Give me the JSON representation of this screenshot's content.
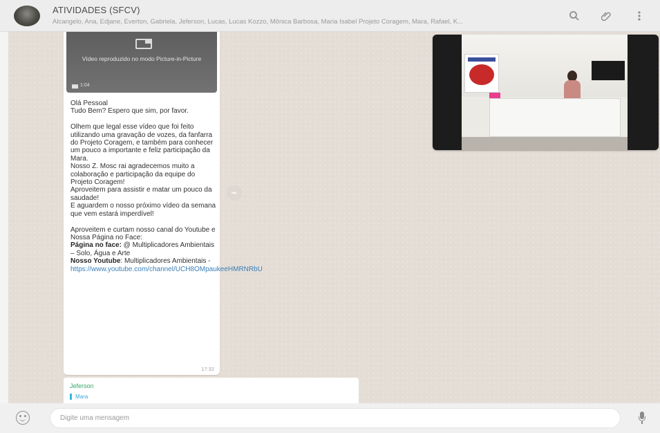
{
  "header": {
    "title": "ATIVIDADES (SFCV)",
    "members": "Alcangelo, Ana, Edjane, Everton, Gabriela, Jeferson, Lucas, Lucas Kozzo, Mônica Barbosa, Maria Isabel Projeto Coragem, Mara, Rafael, K...",
    "icons": {
      "search": "search-icon",
      "attach": "paperclip-icon",
      "menu": "menu-icon"
    }
  },
  "message": {
    "video_caption": "Vídeo reproduzido no modo Picture-in-Picture",
    "video_duration": "1:04",
    "lines": {
      "p1": "Olá Pessoal\nTudo Bem? Espero que sim, por favor.\n\nOlhem que legal esse vídeo que foi feito utilizando uma gravação de vozes, da fanfarra do Projeto Coragem, e também para conhecer um pouco a importante e feliz participação da Mara.\nNosso Z. Mosc rai agradecemos muito a colaboração e participação da equipe do Projeto Coragem!\nAproveitem para assistir e matar um pouco da saudade!\nE aguardem o nosso próximo vídeo da semana que vem estará imperdível!\n\nAproveitem e curtam nosso canal do Youtube e Nossa Página no Face:",
      "face_label": "Página no face:",
      "face_value": " @ Multiplicadores Ambientais – Solo, Água e Arte",
      "yt_label": "Nosso Youtube",
      "yt_value": ": Multiplicadores Ambientais -",
      "link": "https://www.youtube.com/channel/UCH8OMpaukeeHMRNRbU"
    },
    "time": "17:32"
  },
  "reply": {
    "author": "Jeferson",
    "quote": "Mara"
  },
  "composer": {
    "placeholder": "Digite uma mensagem"
  },
  "colors": {
    "chat_bg": "#e4ddd6",
    "author_green": "#3aa66a",
    "link_blue": "#3a7fb8"
  }
}
